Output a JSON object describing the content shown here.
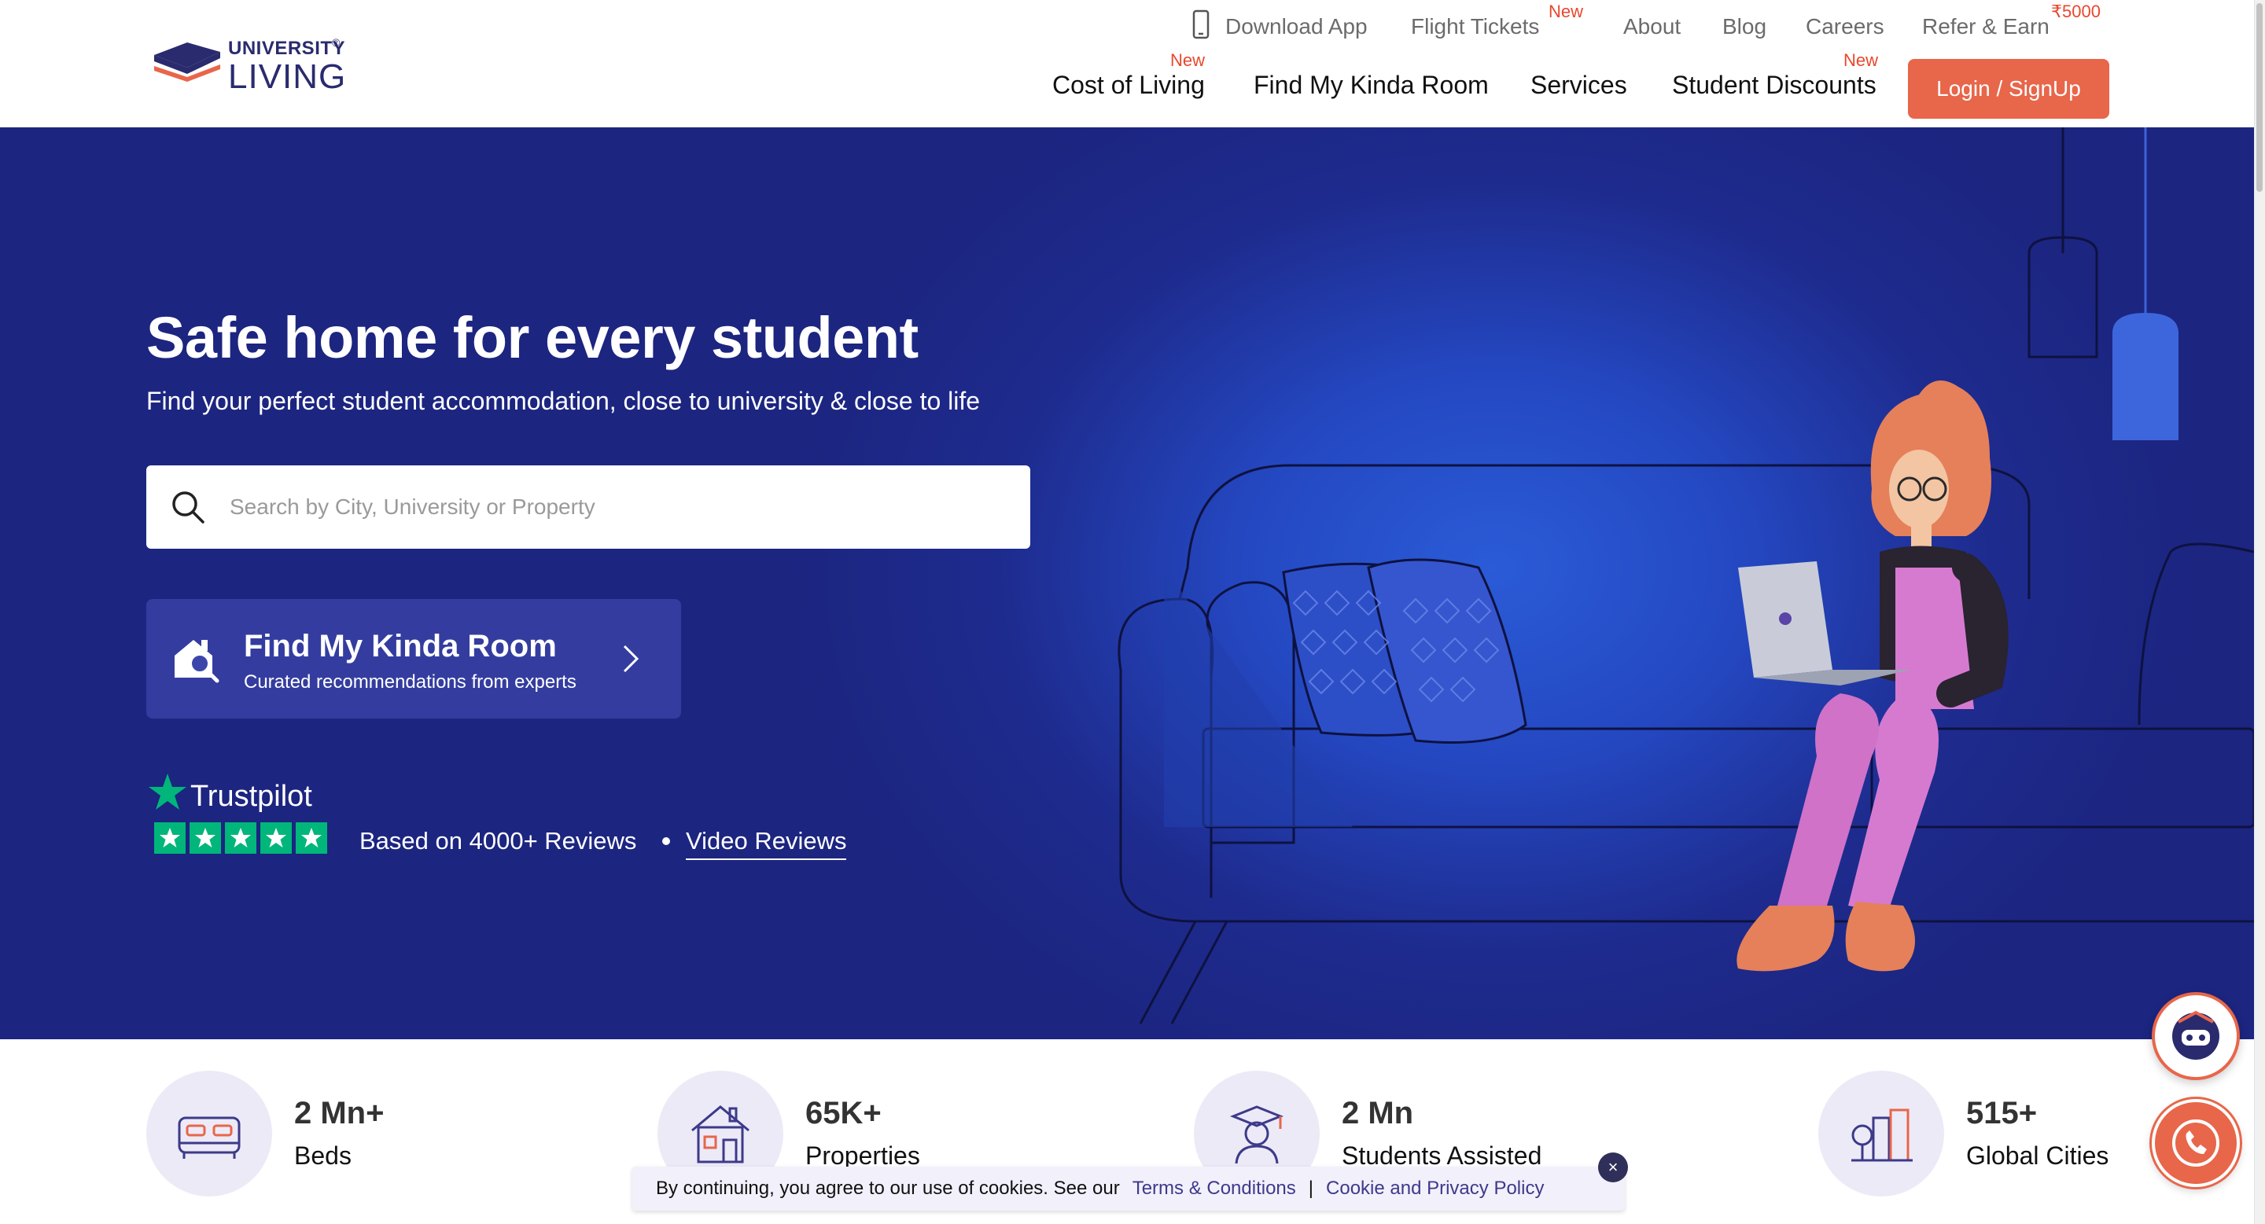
{
  "header": {
    "logo": {
      "line1": "UNIVERSITY",
      "line2": "LIVING",
      "reg": "®"
    },
    "top_nav": [
      {
        "label": "Download App"
      },
      {
        "label": "Flight Tickets",
        "badge": "New"
      },
      {
        "label": "About"
      },
      {
        "label": "Blog"
      },
      {
        "label": "Careers"
      },
      {
        "label": "Refer & Earn",
        "badge": "₹5000"
      }
    ],
    "main_nav": [
      {
        "label": "Cost of Living",
        "badge": "New"
      },
      {
        "label": "Find My Kinda Room"
      },
      {
        "label": "Services"
      },
      {
        "label": "Student Discounts",
        "badge": "New"
      }
    ],
    "login_label": "Login / SignUp"
  },
  "hero": {
    "title": "Safe home for every student",
    "subtitle": "Find your perfect student accommodation, close to university & close to life",
    "search": {
      "placeholder": "Search by City, University or Property",
      "value": ""
    },
    "kinda_card": {
      "title": "Find My Kinda Room",
      "subtitle": "Curated recommendations from experts"
    },
    "trustpilot": {
      "brand": "Trustpilot",
      "stars": 5,
      "reviews_text": "Based on 4000+ Reviews",
      "video_link": "Video Reviews"
    }
  },
  "stats": [
    {
      "value": "2 Mn+",
      "label": "Beds",
      "icon": "bed-icon"
    },
    {
      "value": "65K+",
      "label": "Properties",
      "icon": "house-icon"
    },
    {
      "value": "2 Mn",
      "label": "Students Assisted",
      "icon": "graduate-icon"
    },
    {
      "value": "515+",
      "label": "Global Cities",
      "icon": "city-icon"
    }
  ],
  "cookie": {
    "text": "By continuing, you agree to our use of cookies. See our",
    "terms": "Terms & Conditions",
    "separator": "|",
    "policy": "Cookie and Privacy Policy",
    "close": "×"
  },
  "colors": {
    "brand_navy": "#2a2b6e",
    "accent_orange": "#e8664a",
    "badge_red": "#e8482c",
    "hero_blue": "#1e2b8e",
    "trustpilot_green": "#00b67a"
  }
}
